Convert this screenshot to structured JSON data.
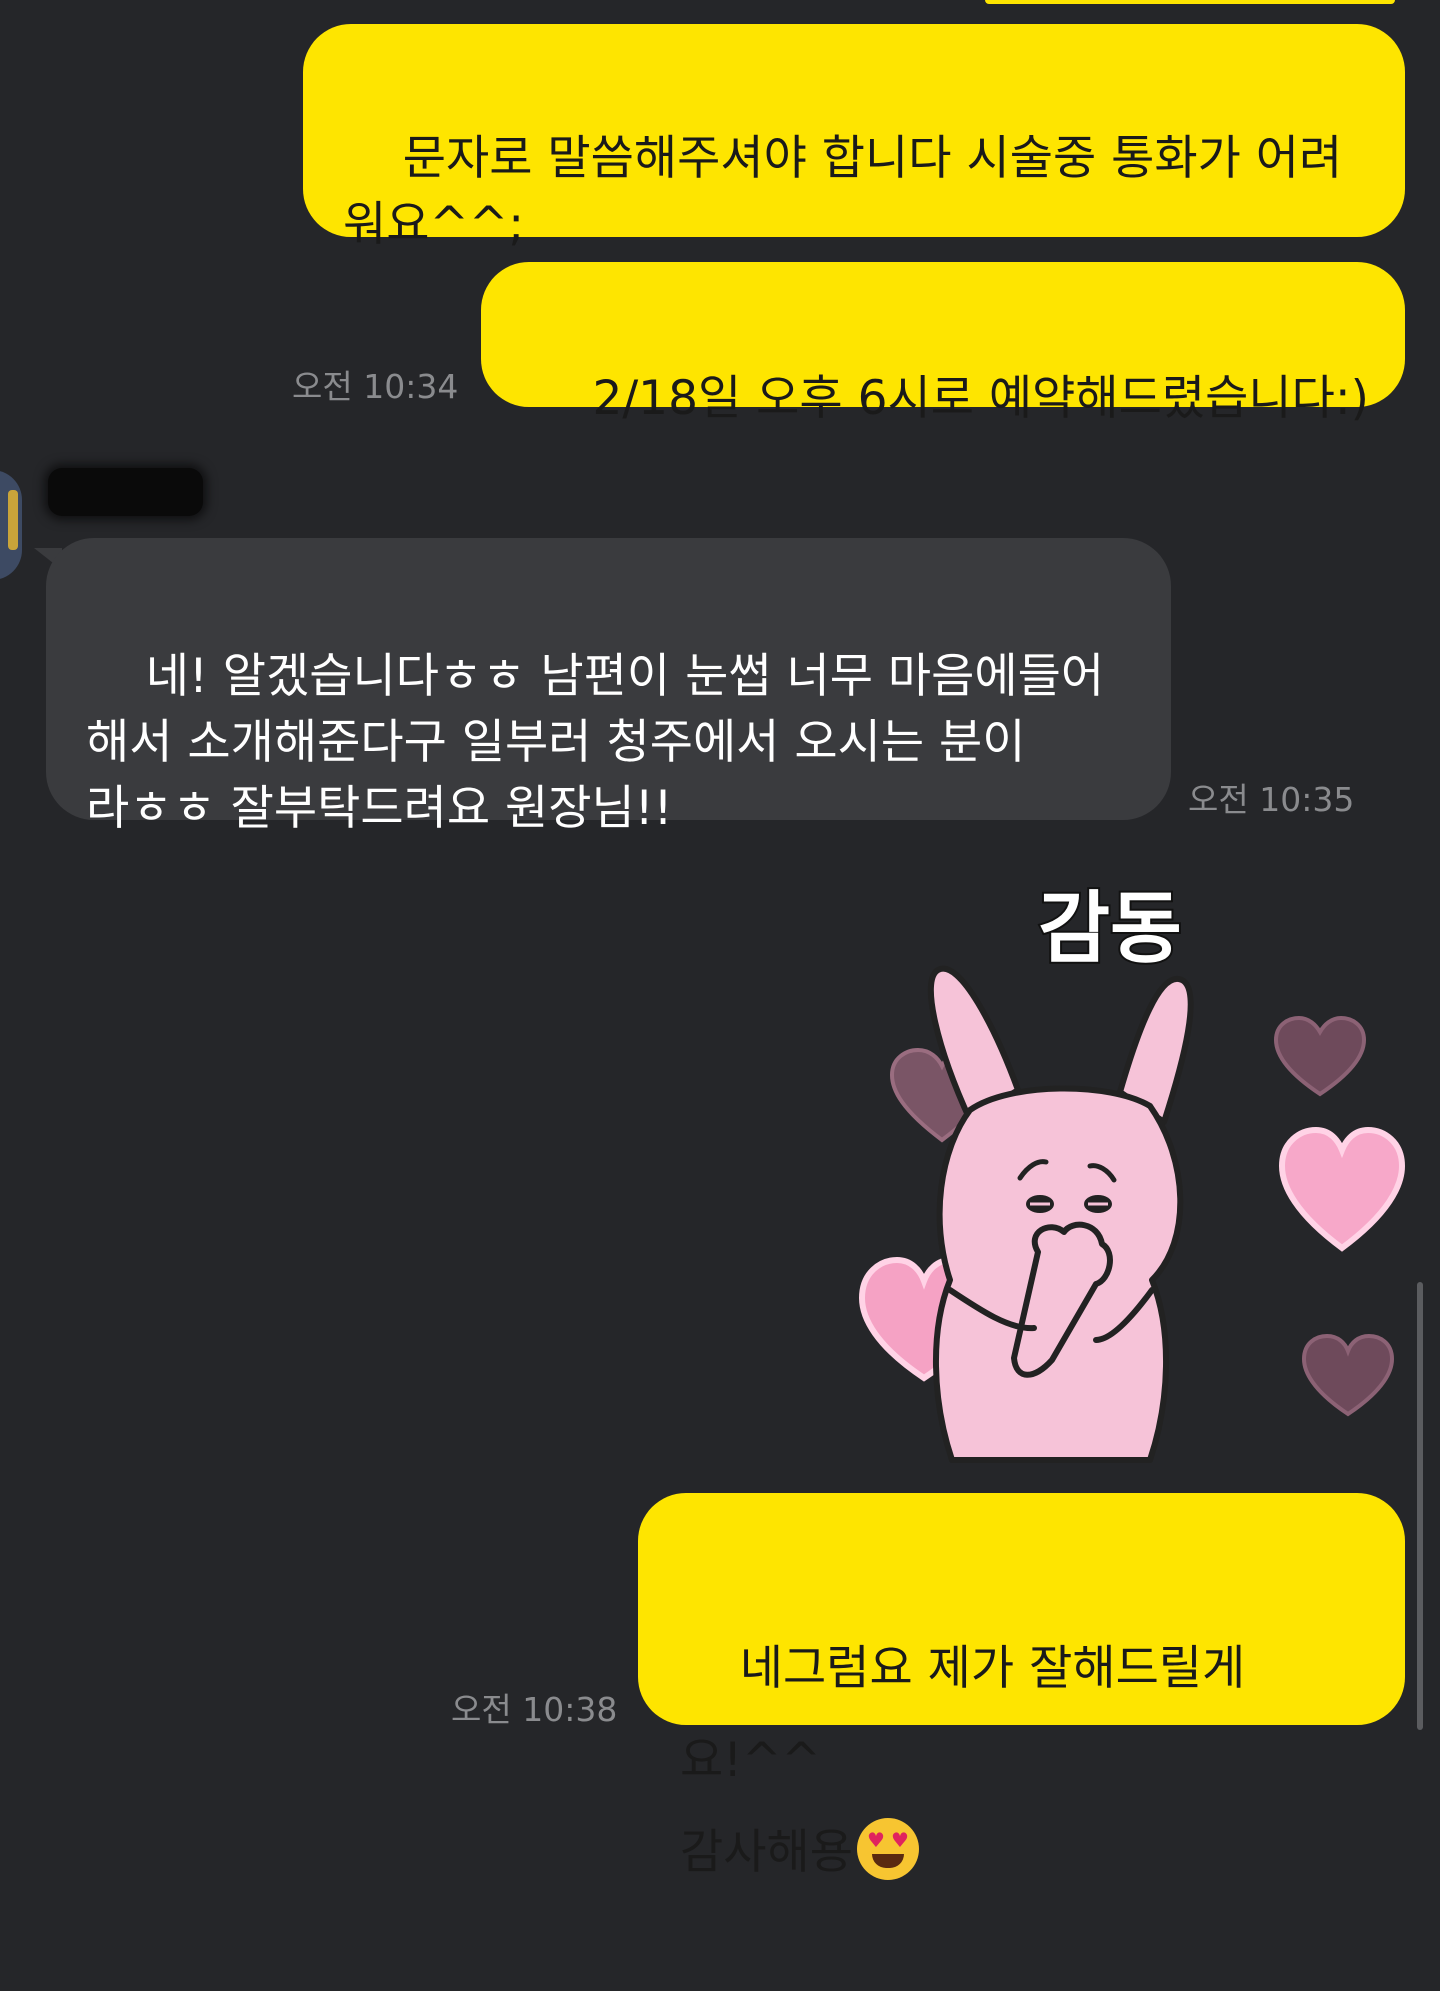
{
  "messages": [
    {
      "direction": "outgoing",
      "text": "문자로 말씀해주셔야 합니다 시술중 통화가 어려\n워요^^;"
    },
    {
      "direction": "outgoing",
      "text": "2/18일 오후 6시로 예약해드렸습니다:)",
      "time": "오전 10:34"
    },
    {
      "direction": "incoming",
      "text": "네! 알겠습니다ㅎㅎ 남편이 눈썹 너무 마음에들어\n해서 소개해준다구 일부러 청주에서 오시는 분이\n라ㅎㅎ 잘부탁드려요 원장님!!",
      "time": "오전 10:35"
    },
    {
      "direction": "outgoing",
      "type": "sticker",
      "sticker_text": "감동"
    },
    {
      "direction": "outgoing",
      "text": "네그럼요 제가 잘해드릴게요!^^\n감사해용",
      "emoji": "smiling-face-with-heart-eyes",
      "time": "오전 10:38"
    }
  ],
  "colors": {
    "background": "#252629",
    "outgoing_bubble": "#FEE500",
    "incoming_bubble": "#3a3b3e",
    "timestamp": "#8a8b8e"
  }
}
